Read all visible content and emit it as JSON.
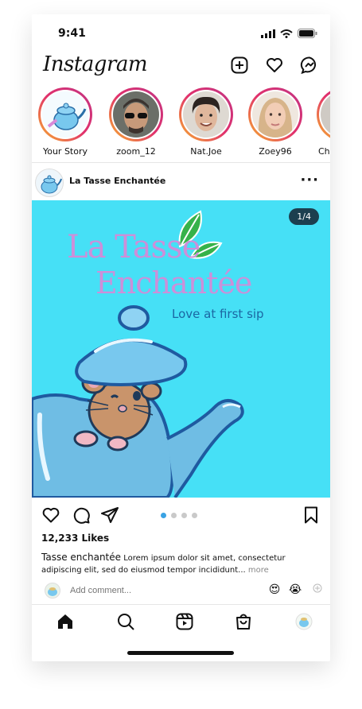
{
  "status": {
    "time": "9:41"
  },
  "app": {
    "title": "Instagram"
  },
  "stories": [
    {
      "name": "Your Story"
    },
    {
      "name": "zoom_12"
    },
    {
      "name": "Nat.Joe"
    },
    {
      "name": "Zoey96"
    },
    {
      "name": "Che"
    }
  ],
  "post": {
    "username": "La Tasse Enchantée",
    "counter": "1/4",
    "brand_line1": "La Tasse",
    "brand_line2": "Enchantée",
    "tagline": "Love at first sip",
    "likes": "12,233 Likes",
    "caption_user": "Tasse enchantée",
    "caption_text": "Lorem ipsum dolor sit amet, consectetur adipiscing elit, sed do eiusmod tempor incididunt...",
    "caption_more": "more",
    "comment_placeholder": "Add comment..."
  },
  "colors": {
    "accent_dot": "#3aa3e4",
    "post_bg": "#46e0f6",
    "brand": "#cc8fd9"
  },
  "icons": [
    "new-post-icon",
    "heart-icon",
    "messenger-icon",
    "like-icon",
    "comment-icon",
    "share-icon",
    "save-icon",
    "home-icon",
    "search-icon",
    "reels-icon",
    "shop-icon",
    "profile-icon"
  ]
}
